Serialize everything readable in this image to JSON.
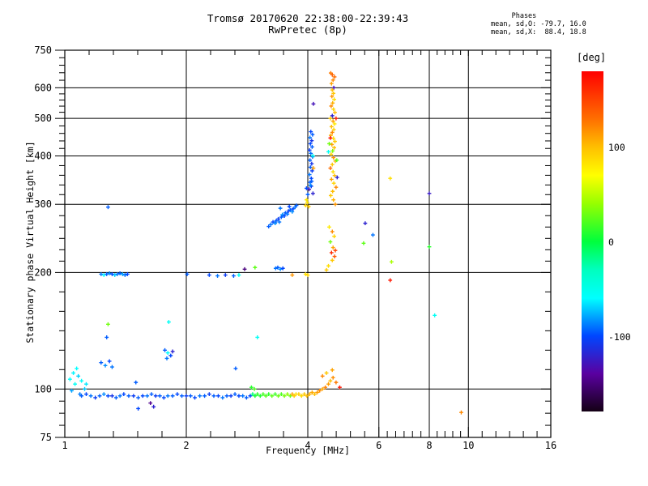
{
  "header": {
    "title": "Tromsø 20170620 22:38:00-22:39:43",
    "subtitle": "RwPretec (8p)",
    "stats_block": "     Phases\nmean, sd,O: -79.7, 16.0\nmean, sd,X:  88.4, 18.8"
  },
  "chart_data": {
    "type": "scatter",
    "title": "Tromsø 20170620 22:38:00-22:39:43",
    "subtitle": "RwPretec (8p)",
    "xlabel": "Frequency [MHz]",
    "ylabel": "Stationary phase Virtual Height [km]",
    "xscale": "log",
    "yscale": "log",
    "xlim": [
      1,
      16
    ],
    "ylim": [
      75,
      750
    ],
    "x_major_ticks": [
      1,
      2,
      4,
      6,
      8,
      10,
      16
    ],
    "x_gridlines": [
      2,
      4,
      6,
      8,
      10
    ],
    "x_minor_counts": [
      4,
      4,
      4,
      5,
      4,
      5
    ],
    "y_major_ticks": [
      750,
      600,
      500,
      400,
      300,
      200,
      100,
      75
    ],
    "y_gridlines": [
      600,
      500,
      400,
      300,
      200,
      100
    ],
    "y_minor_counts": [
      4,
      4,
      4,
      4,
      5,
      5,
      3
    ],
    "grid": true,
    "marker": "plus",
    "colorbar": {
      "title": "[deg]",
      "min": -180,
      "max": 180,
      "ticks": [
        100,
        0,
        -100
      ],
      "stops": [
        [
          180,
          "#ff0000"
        ],
        [
          130,
          "#ff6e00"
        ],
        [
          100,
          "#ffbe00"
        ],
        [
          70,
          "#ffff00"
        ],
        [
          40,
          "#96ff00"
        ],
        [
          0,
          "#00ff3c"
        ],
        [
          -30,
          "#00ffbe"
        ],
        [
          -60,
          "#00ffff"
        ],
        [
          -100,
          "#0046ff"
        ],
        [
          -140,
          "#5a00a0"
        ],
        [
          -180,
          "#140014"
        ]
      ]
    },
    "points_format": [
      "freq_MHz",
      "virtual_height_km",
      "phase_deg"
    ],
    "points": [
      [
        1.03,
        106,
        -60
      ],
      [
        1.05,
        110,
        -62
      ],
      [
        1.06,
        103,
        -55
      ],
      [
        1.08,
        108,
        -70
      ],
      [
        1.1,
        105,
        -58
      ],
      [
        1.12,
        100,
        -72
      ],
      [
        1.07,
        113,
        -60
      ],
      [
        1.04,
        99,
        -80
      ],
      [
        1.09,
        97,
        -88
      ],
      [
        1.13,
        103,
        -65
      ],
      [
        1.1,
        96,
        -95
      ],
      [
        1.13,
        97,
        -100
      ],
      [
        1.16,
        96,
        -90
      ],
      [
        1.19,
        95,
        -105
      ],
      [
        1.22,
        96,
        -95
      ],
      [
        1.25,
        97,
        -85
      ],
      [
        1.28,
        96,
        -100
      ],
      [
        1.31,
        96,
        -110
      ],
      [
        1.34,
        95,
        -95
      ],
      [
        1.37,
        96,
        -90
      ],
      [
        1.4,
        97,
        -100
      ],
      [
        1.44,
        96,
        -95
      ],
      [
        1.48,
        96,
        -105
      ],
      [
        1.52,
        95,
        -95
      ],
      [
        1.56,
        96,
        -100
      ],
      [
        1.6,
        96,
        -90
      ],
      [
        1.64,
        97,
        -95
      ],
      [
        1.68,
        96,
        -105
      ],
      [
        1.72,
        96,
        -95
      ],
      [
        1.76,
        95,
        -100
      ],
      [
        1.8,
        96,
        -90
      ],
      [
        1.85,
        96,
        -95
      ],
      [
        1.9,
        97,
        -100
      ],
      [
        1.95,
        96,
        -95
      ],
      [
        2.0,
        96,
        -105
      ],
      [
        2.05,
        96,
        -95
      ],
      [
        2.1,
        95,
        -100
      ],
      [
        2.16,
        96,
        -90
      ],
      [
        2.22,
        96,
        -95
      ],
      [
        2.28,
        97,
        -105
      ],
      [
        2.34,
        96,
        -95
      ],
      [
        2.4,
        96,
        -100
      ],
      [
        2.46,
        95,
        -90
      ],
      [
        2.52,
        96,
        -95
      ],
      [
        2.58,
        96,
        -105
      ],
      [
        2.64,
        97,
        -95
      ],
      [
        2.7,
        96,
        -100
      ],
      [
        2.76,
        96,
        -90
      ],
      [
        2.82,
        95,
        -95
      ],
      [
        2.88,
        96,
        -100
      ],
      [
        2.92,
        97,
        -15
      ],
      [
        2.96,
        96,
        5
      ],
      [
        3.0,
        97,
        12
      ],
      [
        3.05,
        96,
        8
      ],
      [
        3.1,
        97,
        18
      ],
      [
        3.15,
        96,
        22
      ],
      [
        3.2,
        97,
        12
      ],
      [
        3.26,
        96,
        25
      ],
      [
        3.32,
        97,
        15
      ],
      [
        3.38,
        96,
        28
      ],
      [
        3.44,
        97,
        20
      ],
      [
        3.5,
        96,
        32
      ],
      [
        3.56,
        97,
        38
      ],
      [
        3.62,
        96,
        30
      ],
      [
        2.9,
        101,
        10
      ],
      [
        2.95,
        100,
        20
      ],
      [
        3.66,
        97,
        108
      ],
      [
        3.7,
        96,
        95
      ],
      [
        3.74,
        97,
        85
      ],
      [
        3.8,
        97,
        92
      ],
      [
        3.86,
        96,
        88
      ],
      [
        3.92,
        97,
        96
      ],
      [
        3.98,
        96,
        100
      ],
      [
        4.04,
        97,
        105
      ],
      [
        4.1,
        98,
        108
      ],
      [
        4.16,
        97,
        100
      ],
      [
        4.22,
        98,
        112
      ],
      [
        4.28,
        99,
        118
      ],
      [
        4.35,
        100,
        108
      ],
      [
        4.42,
        101,
        122
      ],
      [
        4.5,
        103,
        112
      ],
      [
        4.55,
        105,
        100
      ],
      [
        4.62,
        107,
        118
      ],
      [
        4.7,
        104,
        125
      ],
      [
        4.8,
        101,
        170
      ],
      [
        4.45,
        110,
        95
      ],
      [
        4.6,
        112,
        110
      ],
      [
        4.35,
        108,
        120
      ],
      [
        1.5,
        104,
        -95
      ],
      [
        1.63,
        92,
        -145
      ],
      [
        1.52,
        89,
        -100
      ],
      [
        1.66,
        90,
        -120
      ],
      [
        1.23,
        198,
        -90
      ],
      [
        1.25,
        197,
        -60
      ],
      [
        1.27,
        198,
        -95
      ],
      [
        1.29,
        199,
        -85
      ],
      [
        1.31,
        198,
        -100
      ],
      [
        1.33,
        197,
        -70
      ],
      [
        1.35,
        198,
        -90
      ],
      [
        1.37,
        199,
        -95
      ],
      [
        1.39,
        198,
        -80
      ],
      [
        1.41,
        197,
        -90
      ],
      [
        1.43,
        198,
        -100
      ],
      [
        2.01,
        198,
        -95
      ],
      [
        2.28,
        197,
        -100
      ],
      [
        2.39,
        196,
        -90
      ],
      [
        2.5,
        197,
        -105
      ],
      [
        2.62,
        196,
        -95
      ],
      [
        2.7,
        197,
        -55
      ],
      [
        2.79,
        204,
        -150
      ],
      [
        2.96,
        206,
        25
      ],
      [
        3.33,
        205,
        -90
      ],
      [
        3.37,
        206,
        -95
      ],
      [
        3.42,
        204,
        -85
      ],
      [
        3.47,
        205,
        -100
      ],
      [
        3.66,
        197,
        115
      ],
      [
        3.95,
        198,
        85
      ],
      [
        4.0,
        197,
        90
      ],
      [
        4.45,
        203,
        95
      ],
      [
        3.2,
        263,
        -95
      ],
      [
        3.24,
        266,
        -90
      ],
      [
        3.28,
        270,
        -100
      ],
      [
        3.32,
        268,
        -85
      ],
      [
        3.34,
        272,
        -95
      ],
      [
        3.38,
        275,
        -105
      ],
      [
        3.4,
        270,
        -90
      ],
      [
        3.44,
        278,
        -95
      ],
      [
        3.46,
        282,
        -85
      ],
      [
        3.5,
        280,
        -100
      ],
      [
        3.52,
        285,
        -95
      ],
      [
        3.56,
        283,
        -90
      ],
      [
        3.58,
        288,
        -105
      ],
      [
        3.62,
        290,
        -95
      ],
      [
        3.66,
        287,
        -85
      ],
      [
        3.68,
        292,
        -100
      ],
      [
        3.72,
        295,
        -90
      ],
      [
        3.75,
        298,
        -95
      ],
      [
        3.42,
        293,
        -90
      ],
      [
        3.6,
        296,
        -100
      ],
      [
        3.95,
        298,
        90
      ],
      [
        3.99,
        303,
        85
      ],
      [
        4.02,
        296,
        95
      ],
      [
        3.97,
        308,
        80
      ],
      [
        4.05,
        342,
        -95
      ],
      [
        4.08,
        350,
        -100
      ],
      [
        4.04,
        358,
        -90
      ],
      [
        4.1,
        366,
        -105
      ],
      [
        4.06,
        374,
        -95
      ],
      [
        4.09,
        382,
        -110
      ],
      [
        4.05,
        390,
        -95
      ],
      [
        4.11,
        398,
        -100
      ],
      [
        4.07,
        406,
        -90
      ],
      [
        4.04,
        414,
        -105
      ],
      [
        4.1,
        422,
        -95
      ],
      [
        4.06,
        430,
        -100
      ],
      [
        4.09,
        438,
        -110
      ],
      [
        4.05,
        446,
        -90
      ],
      [
        4.11,
        454,
        -95
      ],
      [
        4.07,
        462,
        -100
      ],
      [
        4.03,
        328,
        -130
      ],
      [
        4.08,
        334,
        -105
      ],
      [
        4.12,
        320,
        -120
      ],
      [
        4.0,
        318,
        -95
      ],
      [
        3.97,
        330,
        -100
      ],
      [
        4.12,
        400,
        -50
      ],
      [
        4.13,
        372,
        110
      ],
      [
        4.13,
        545,
        -130
      ],
      [
        4.06,
        336,
        -85
      ],
      [
        4.09,
        344,
        -95
      ],
      [
        4.62,
        628,
        120
      ],
      [
        4.66,
        640,
        130
      ],
      [
        4.58,
        615,
        110
      ],
      [
        4.56,
        655,
        125
      ],
      [
        4.6,
        648,
        135
      ],
      [
        4.64,
        600,
        -130
      ],
      [
        4.6,
        592,
        100
      ],
      [
        4.63,
        580,
        95
      ],
      [
        4.59,
        570,
        115
      ],
      [
        4.65,
        560,
        85
      ],
      [
        4.61,
        548,
        105
      ],
      [
        4.57,
        538,
        120
      ],
      [
        4.63,
        528,
        90
      ],
      [
        4.67,
        518,
        100
      ],
      [
        4.6,
        508,
        -120
      ],
      [
        4.55,
        500,
        95
      ],
      [
        4.62,
        492,
        110
      ],
      [
        4.66,
        484,
        80
      ],
      [
        4.58,
        476,
        100
      ],
      [
        4.64,
        468,
        90
      ],
      [
        4.6,
        460,
        120
      ],
      [
        4.56,
        452,
        105
      ],
      [
        4.63,
        444,
        85
      ],
      [
        4.67,
        436,
        95
      ],
      [
        4.59,
        428,
        110
      ],
      [
        4.65,
        420,
        100
      ],
      [
        4.61,
        412,
        35
      ],
      [
        4.57,
        404,
        90
      ],
      [
        4.63,
        396,
        115
      ],
      [
        4.68,
        388,
        105
      ],
      [
        4.6,
        380,
        95
      ],
      [
        4.55,
        372,
        130
      ],
      [
        4.62,
        364,
        85
      ],
      [
        4.66,
        356,
        100
      ],
      [
        4.58,
        348,
        110
      ],
      [
        4.64,
        340,
        90
      ],
      [
        4.7,
        332,
        120
      ],
      [
        4.61,
        324,
        100
      ],
      [
        4.56,
        316,
        95
      ],
      [
        4.63,
        308,
        105
      ],
      [
        4.68,
        300,
        115
      ],
      [
        4.52,
        430,
        30
      ],
      [
        4.72,
        390,
        25
      ],
      [
        4.7,
        500,
        165
      ],
      [
        4.55,
        445,
        170
      ],
      [
        4.5,
        410,
        -55
      ],
      [
        4.73,
        352,
        -120
      ],
      [
        4.52,
        262,
        80
      ],
      [
        4.6,
        255,
        120
      ],
      [
        4.65,
        248,
        90
      ],
      [
        4.55,
        240,
        30
      ],
      [
        4.62,
        232,
        110
      ],
      [
        4.58,
        225,
        160
      ],
      [
        4.66,
        220,
        140
      ],
      [
        4.6,
        215,
        95
      ],
      [
        4.5,
        208,
        85
      ],
      [
        4.68,
        228,
        150
      ],
      [
        1.28,
        295,
        -95
      ],
      [
        1.28,
        147,
        30
      ],
      [
        1.27,
        136,
        -95
      ],
      [
        1.81,
        149,
        -55
      ],
      [
        1.77,
        126,
        -95
      ],
      [
        1.8,
        124,
        -60
      ],
      [
        1.83,
        122,
        -100
      ],
      [
        1.85,
        125,
        -120
      ],
      [
        1.79,
        120,
        -90
      ],
      [
        1.23,
        117,
        -95
      ],
      [
        1.26,
        115,
        -85
      ],
      [
        1.29,
        118,
        -100
      ],
      [
        1.31,
        114,
        -90
      ],
      [
        3.0,
        136,
        -55
      ],
      [
        2.65,
        113,
        -95
      ],
      [
        5.55,
        268,
        -120
      ],
      [
        5.8,
        250,
        -90
      ],
      [
        5.5,
        238,
        25
      ],
      [
        6.4,
        350,
        85
      ],
      [
        8.0,
        320,
        -125
      ],
      [
        8.0,
        233,
        10
      ],
      [
        6.45,
        213,
        45
      ],
      [
        6.4,
        191,
        170
      ],
      [
        8.25,
        155,
        -55
      ],
      [
        9.6,
        87,
        120
      ]
    ]
  }
}
